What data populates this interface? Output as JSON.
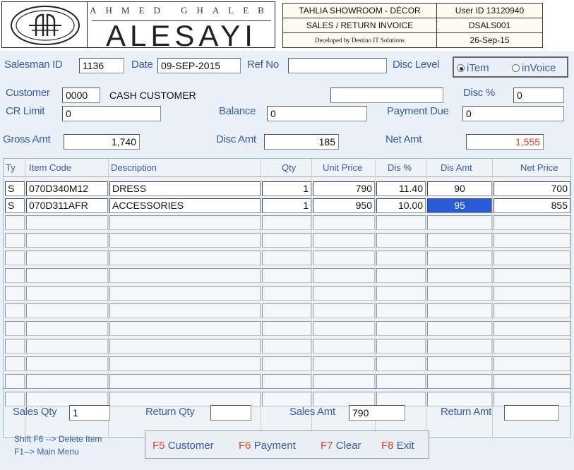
{
  "header": {
    "brand_small": "AHMED GHALEB",
    "brand_big": "ALESAYI",
    "showroom": "TAHLIA SHOWROOM - DÉCOR",
    "user_id": "User ID 13120940",
    "invoice_title": "SALES / RETURN INVOICE",
    "form_code": "DSALS001",
    "developer": "Deceloped by Destino IT Solutions",
    "date": "26-Sep-15"
  },
  "form": {
    "salesman_label": "Salesman ID",
    "salesman_value": "1136",
    "date_label": "Date",
    "date_value": "09-SEP-2015",
    "ref_label": "Ref No",
    "ref_value": "",
    "disc_level_label": "Disc Level",
    "disc_level_options": [
      "iTem",
      "inVoice"
    ],
    "disc_level_selected": "iTem",
    "customer_label": "Customer",
    "customer_code": "0000",
    "customer_name": "CASH CUSTOMER",
    "customer_extra": "",
    "disc_pct_label": "Disc %",
    "disc_pct_value": "0",
    "cr_limit_label": "CR Limit",
    "cr_limit_value": "0",
    "balance_label": "Balance",
    "balance_value": "0",
    "payment_due_label": "Payment Due",
    "payment_due_value": "0",
    "gross_label": "Gross Amt",
    "gross_value": "1,740",
    "disc_amt_label": "Disc Amt",
    "disc_amt_value": "185",
    "net_label": "Net Amt",
    "net_value": "1,555"
  },
  "grid": {
    "columns": [
      "Ty",
      "Item Code",
      "Description",
      "Qty",
      "Unit Price",
      "Dis %",
      "Dis Amt",
      "Net Price"
    ],
    "rows": [
      {
        "ty": "S",
        "code": "070D340M12",
        "desc": "DRESS",
        "qty": "1",
        "unit": "790",
        "dis_pct": "11.40",
        "dis_amt": "90",
        "net": "700"
      },
      {
        "ty": "S",
        "code": "070D311AFR",
        "desc": "ACCESSORIES",
        "qty": "1",
        "unit": "950",
        "dis_pct": "10.00",
        "dis_amt": "95",
        "net": "855"
      }
    ],
    "selected_cell": "dis_amt-row-2"
  },
  "totals": {
    "sales_qty_label": "Sales Qty",
    "sales_qty_value": "1",
    "return_qty_label": "Return Qty",
    "return_qty_value": "",
    "sales_amt_label": "Sales Amt",
    "sales_amt_value": "790",
    "return_amt_label": "Return Amt",
    "return_amt_value": ""
  },
  "footer": {
    "hint1": "Shift F6 --> Delete Item",
    "hint2": "F1--> Main Menu",
    "keys": [
      {
        "key": "F5",
        "label": "Customer"
      },
      {
        "key": "F6",
        "label": "Payment"
      },
      {
        "key": "F7",
        "label": "Clear"
      },
      {
        "key": "F8",
        "label": "Exit"
      }
    ]
  },
  "colors": {
    "label_blue": "#3b5aa8",
    "accent_red": "#e0402a",
    "panel_bg": "#e9f0f7",
    "selection": "#2a5bd7"
  }
}
